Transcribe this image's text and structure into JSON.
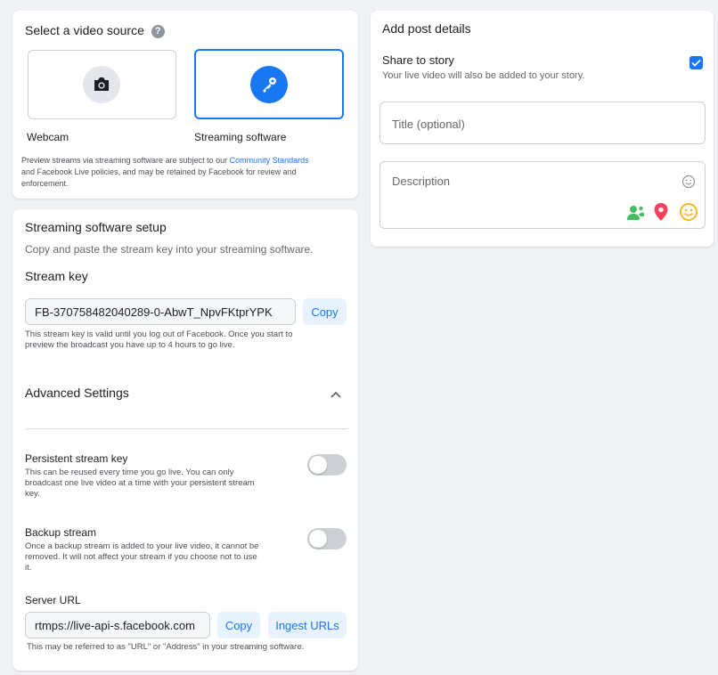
{
  "video_source": {
    "title": "Select a video source",
    "help_icon": "?",
    "webcam_label": "Webcam",
    "streaming_label": "Streaming software",
    "notice_prefix": "Preview streams via streaming software are subject to our ",
    "notice_link": "Community Standards",
    "notice_suffix_line1": " and Facebook Live policies, and may be retained by Facebook for review and",
    "notice_suffix_line2": "enforcement."
  },
  "setup": {
    "title": "Streaming software setup",
    "instructions": "Copy and paste the stream key into your streaming software.",
    "stream_key_label": "Stream key",
    "stream_key_value": "FB-370758482040289-0-AbwT_NpvFKtprYPK",
    "copy_label": "Copy",
    "stream_key_note_line1": "This stream key is valid until you log out of Facebook. Once you start to",
    "stream_key_note_line2": "preview the broadcast you have up to 4 hours to go live.",
    "advanced_title": "Advanced Settings",
    "persistent": {
      "title": "Persistent stream key",
      "desc_line1": "This can be reused every time you go live. You can only",
      "desc_line2": "broadcast one live video at a time with your persistent stream",
      "desc_line3": "key.",
      "enabled": false
    },
    "backup": {
      "title": "Backup stream",
      "desc_line1": "Once a backup stream is added to your live video, it cannot be",
      "desc_line2": "removed. It will not affect your stream if you choose not to use",
      "desc_line3": "it.",
      "enabled": false
    },
    "server_url_label": "Server URL",
    "server_url_value": "rtmps://live-api-s.facebook.com",
    "server_copy_label": "Copy",
    "ingest_label": "Ingest URLs",
    "server_note": "This may be referred to as \"URL\" or \"Address\" in your streaming software."
  },
  "post_details": {
    "title": "Add post details",
    "share_title": "Share to story",
    "share_desc": "Your live video will also be added to your story.",
    "share_checked": true,
    "title_placeholder": "Title (optional)",
    "description_placeholder": "Description"
  },
  "colors": {
    "accent": "#1877f2",
    "tag_green": "#45bd62",
    "location_red": "#f3425f",
    "emoji_yellow": "#f7b928"
  }
}
